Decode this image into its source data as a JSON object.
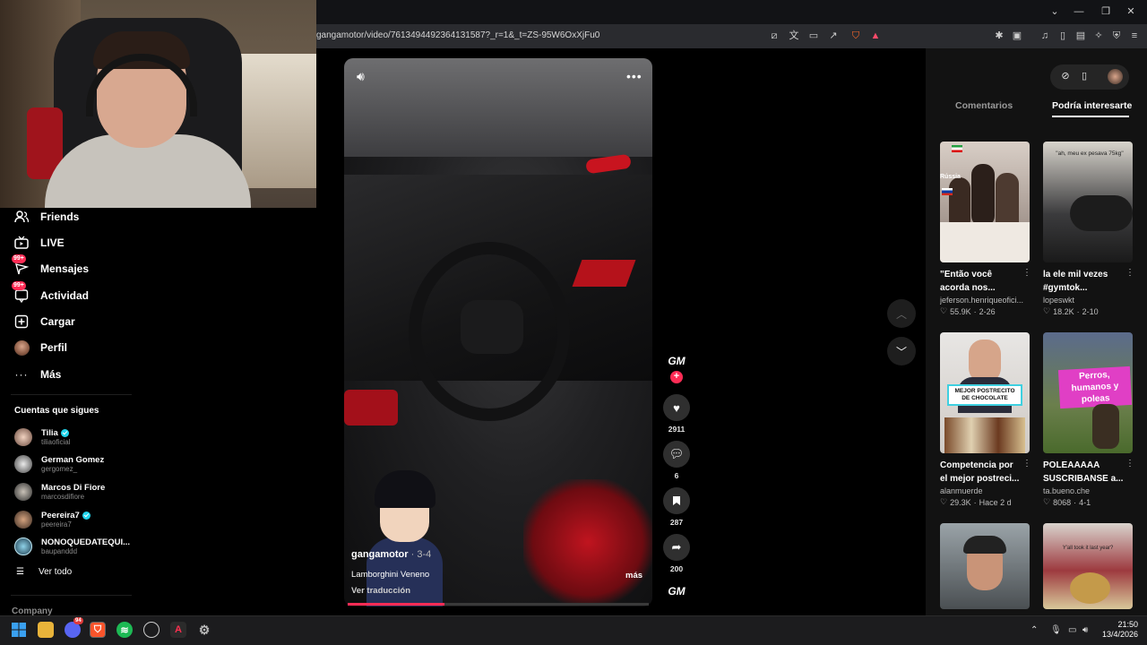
{
  "browser": {
    "url": "gangamotor/video/7613494492364131587?_r=1&_t=ZS-95W6OxXjFu0"
  },
  "sidebar": {
    "items": [
      {
        "label": "Friends",
        "icon": "friends-icon",
        "badge": ""
      },
      {
        "label": "LIVE",
        "icon": "live-icon",
        "badge": ""
      },
      {
        "label": "Mensajes",
        "icon": "messages-icon",
        "badge": "99+"
      },
      {
        "label": "Actividad",
        "icon": "activity-icon",
        "badge": "99+"
      },
      {
        "label": "Cargar",
        "icon": "upload-icon",
        "badge": ""
      },
      {
        "label": "Perfil",
        "icon": "profile-avatar-icon",
        "badge": ""
      },
      {
        "label": "Más",
        "icon": "more-icon",
        "badge": ""
      }
    ],
    "following_header": "Cuentas que sigues",
    "following": [
      {
        "name": "Tilia",
        "handle": "tiliaoficial",
        "verified": true
      },
      {
        "name": "German Gomez",
        "handle": "gergomez_",
        "verified": false
      },
      {
        "name": "Marcos Di Fiore",
        "handle": "marcosdifiore",
        "verified": false
      },
      {
        "name": "Peereira7",
        "handle": "peereira7",
        "verified": true
      },
      {
        "name": "NONOQUEDATEQUI...",
        "handle": "baupanddd",
        "verified": false
      }
    ],
    "see_all": "Ver todo",
    "company": "Company"
  },
  "video": {
    "author": "gangamotor",
    "date": " · 3-4",
    "description": "Lamborghini Veneno",
    "translate": "Ver traducción",
    "more": "más",
    "progress": 0.32,
    "creator_logo": "GM",
    "follow_plus": "+"
  },
  "actions": {
    "likes": "2911",
    "comments": "6",
    "saves": "287",
    "shares": "200"
  },
  "right_panel": {
    "tab_comments": "Comentarios",
    "tab_related": "Podría interesarte",
    "cards": [
      {
        "title": "\"Então você acorda nos...",
        "author": "jeferson.henriqueofici...",
        "likes": "55.9K",
        "date": "2-26",
        "overlay": "Rússia"
      },
      {
        "title": "la ele mil vezes #gymtok...",
        "author": "lopeswkt",
        "likes": "18.2K",
        "date": "2-10",
        "overlay": "\"ah, meu ex pesava 75kg\""
      },
      {
        "title": "Competencia por el mejor postreci...",
        "author": "alanmuerde",
        "likes": "29.3K",
        "date": "Hace 2 d",
        "overlay": "MEJOR POSTRECITO DE CHOCOLATE"
      },
      {
        "title": "POLEAAAAA SUSCRIBANSE a...",
        "author": "ta.bueno.che",
        "likes": "8068",
        "date": "4-1",
        "overlay": "Perros, humanos y poleas"
      },
      {
        "title": "",
        "author": "",
        "likes": "",
        "date": "",
        "overlay": ""
      },
      {
        "title": "",
        "author": "",
        "likes": "",
        "date": "",
        "overlay": "Y'all took it last year?"
      }
    ]
  },
  "taskbar": {
    "time": "21:50",
    "date": "13/4/2026",
    "discord_badge": "94"
  },
  "colors": {
    "accent": "#fe2c55",
    "verified": "#20d5ec",
    "panel": "#121212"
  }
}
